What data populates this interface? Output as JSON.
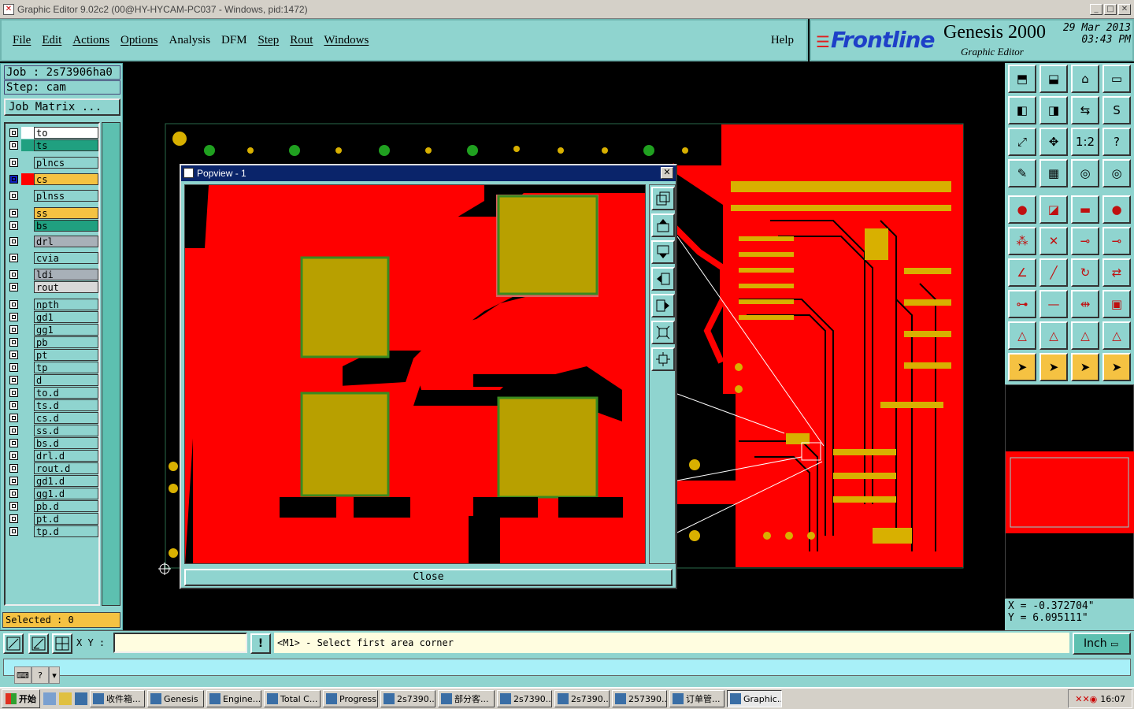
{
  "window": {
    "title": "Graphic Editor 9.02c2 (00@HY-HYCAM-PC037 - Windows, pid:1472)",
    "controls": [
      "_",
      "□",
      "✕"
    ]
  },
  "menu": {
    "items": [
      "File",
      "Edit",
      "Actions",
      "Options",
      "Analysis",
      "DFM",
      "Step",
      "Rout",
      "Windows"
    ],
    "help": "Help"
  },
  "brand": {
    "logo": "Frontline",
    "product": "Genesis 2000",
    "subtitle": "Graphic Editor",
    "date": "29 Mar 2013",
    "time": "03:43 PM"
  },
  "job": {
    "job": "Job : 2s73906ha0",
    "step": "Step: cam",
    "matrix_button": "Job Matrix ..."
  },
  "layers": [
    {
      "name": "to",
      "color": "#ffffff",
      "swatch": "#ffffff"
    },
    {
      "name": "ts",
      "color": "#20a080",
      "swatch": "#20a080"
    },
    {
      "name": "plncs",
      "color": "#8fd4cf",
      "swatch": "#8fd4cf"
    },
    {
      "name": "cs",
      "color": "#f5c242",
      "swatch": "#ff0000",
      "active": true
    },
    {
      "name": "plnss",
      "color": "#8fd4cf",
      "swatch": "#8fd4cf"
    },
    {
      "name": "ss",
      "color": "#f5c242",
      "swatch": "#8fd4cf"
    },
    {
      "name": "bs",
      "color": "#20a080",
      "swatch": "#8fd4cf"
    },
    {
      "name": "drl",
      "color": "#a8b0b8",
      "swatch": "#8fd4cf"
    },
    {
      "name": "cvia",
      "color": "#8fd4cf",
      "swatch": "#8fd4cf"
    },
    {
      "name": "ldi",
      "color": "#a8b0b8",
      "swatch": "#8fd4cf"
    },
    {
      "name": "rout",
      "color": "#d8d8d8",
      "swatch": "#8fd4cf"
    },
    {
      "name": "npth",
      "color": "#8fd4cf",
      "swatch": "#8fd4cf"
    },
    {
      "name": "gd1",
      "color": "#8fd4cf",
      "swatch": "#8fd4cf"
    },
    {
      "name": "gg1",
      "color": "#8fd4cf",
      "swatch": "#8fd4cf"
    },
    {
      "name": "pb",
      "color": "#8fd4cf",
      "swatch": "#8fd4cf"
    },
    {
      "name": "pt",
      "color": "#8fd4cf",
      "swatch": "#8fd4cf"
    },
    {
      "name": "tp",
      "color": "#8fd4cf",
      "swatch": "#8fd4cf"
    },
    {
      "name": "d",
      "color": "#8fd4cf",
      "swatch": "#8fd4cf"
    },
    {
      "name": "to.d",
      "color": "#8fd4cf",
      "swatch": "#8fd4cf"
    },
    {
      "name": "ts.d",
      "color": "#8fd4cf",
      "swatch": "#8fd4cf"
    },
    {
      "name": "cs.d",
      "color": "#8fd4cf",
      "swatch": "#8fd4cf"
    },
    {
      "name": "ss.d",
      "color": "#8fd4cf",
      "swatch": "#8fd4cf"
    },
    {
      "name": "bs.d",
      "color": "#8fd4cf",
      "swatch": "#8fd4cf"
    },
    {
      "name": "drl.d",
      "color": "#8fd4cf",
      "swatch": "#8fd4cf"
    },
    {
      "name": "rout.d",
      "color": "#8fd4cf",
      "swatch": "#8fd4cf"
    },
    {
      "name": "gd1.d",
      "color": "#8fd4cf",
      "swatch": "#8fd4cf"
    },
    {
      "name": "gg1.d",
      "color": "#8fd4cf",
      "swatch": "#8fd4cf"
    },
    {
      "name": "pb.d",
      "color": "#8fd4cf",
      "swatch": "#8fd4cf"
    },
    {
      "name": "pt.d",
      "color": "#8fd4cf",
      "swatch": "#8fd4cf"
    },
    {
      "name": "tp.d",
      "color": "#8fd4cf",
      "swatch": "#8fd4cf"
    }
  ],
  "selected": "Selected : 0",
  "popview": {
    "title": "Popview - 1",
    "close_label": "Close"
  },
  "coords": {
    "x": "X = -0.372704\"",
    "y": "Y =  6.095111\""
  },
  "status": {
    "xy_label": "X Y :",
    "xy_value": "",
    "message": "<M1> - Select first area corner",
    "unit": "Inch"
  },
  "colors": {
    "panel": "#8fd4cf",
    "copper": "#ff0000",
    "pad": "#b8a000",
    "accent_orange": "#f5c242"
  },
  "taskbar": {
    "start": "开始",
    "items": [
      "收件箱...",
      "Genesis",
      "Engine...",
      "Total C...",
      "Progress",
      "2s7390...",
      "部分客...",
      "2s7390...",
      "2s7390...",
      "257390...",
      "订单管...",
      "Graphic..."
    ],
    "clock": "16:07"
  }
}
